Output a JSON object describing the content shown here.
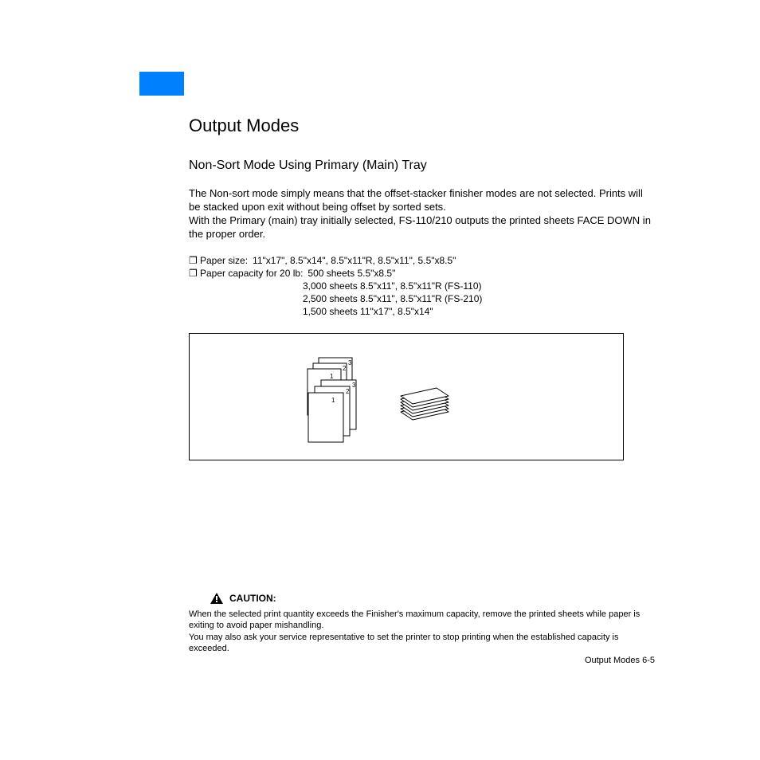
{
  "title": "Output Modes",
  "subtitle": "Non-Sort Mode Using Primary (Main) Tray",
  "body": "The Non-sort mode simply means that the offset-stacker finisher modes are not selected. Prints will be stacked upon exit without being offset by sorted sets.\nWith the Primary (main) tray initially selected, FS-110/210 outputs the printed sheets FACE DOWN in the proper order.",
  "spec1": {
    "bullet": "❐",
    "label": "Paper size:",
    "value": "11\"x17\", 8.5\"x14\", 8.5\"x11\"R, 8.5\"x11\", 5.5\"x8.5\""
  },
  "spec2": {
    "bullet": "❐",
    "label": "Paper capacity for 20 lb:",
    "lines": [
      "500 sheets 5.5\"x8.5\"",
      "3,000 sheets 8.5\"x11\", 8.5\"x11\"R (FS-110)",
      "2,500 sheets 8.5\"x11\", 8.5\"x11\"R (FS-210)",
      "1,500 sheets 11\"x17\", 8.5\"x14\""
    ]
  },
  "diagram": {
    "back_set": {
      "pages": [
        "1",
        "2",
        "3"
      ]
    },
    "front_set": {
      "pages": [
        "1",
        "2",
        "3"
      ]
    }
  },
  "caution": {
    "label": "CAUTION:",
    "text": "When the selected print quantity exceeds the Finisher's maximum capacity, remove the printed sheets while paper is exiting to avoid paper mishandling.\nYou may also ask your service representative to set the printer to stop printing when the established capacity is exceeded."
  },
  "footer": "Output Modes 6-5"
}
